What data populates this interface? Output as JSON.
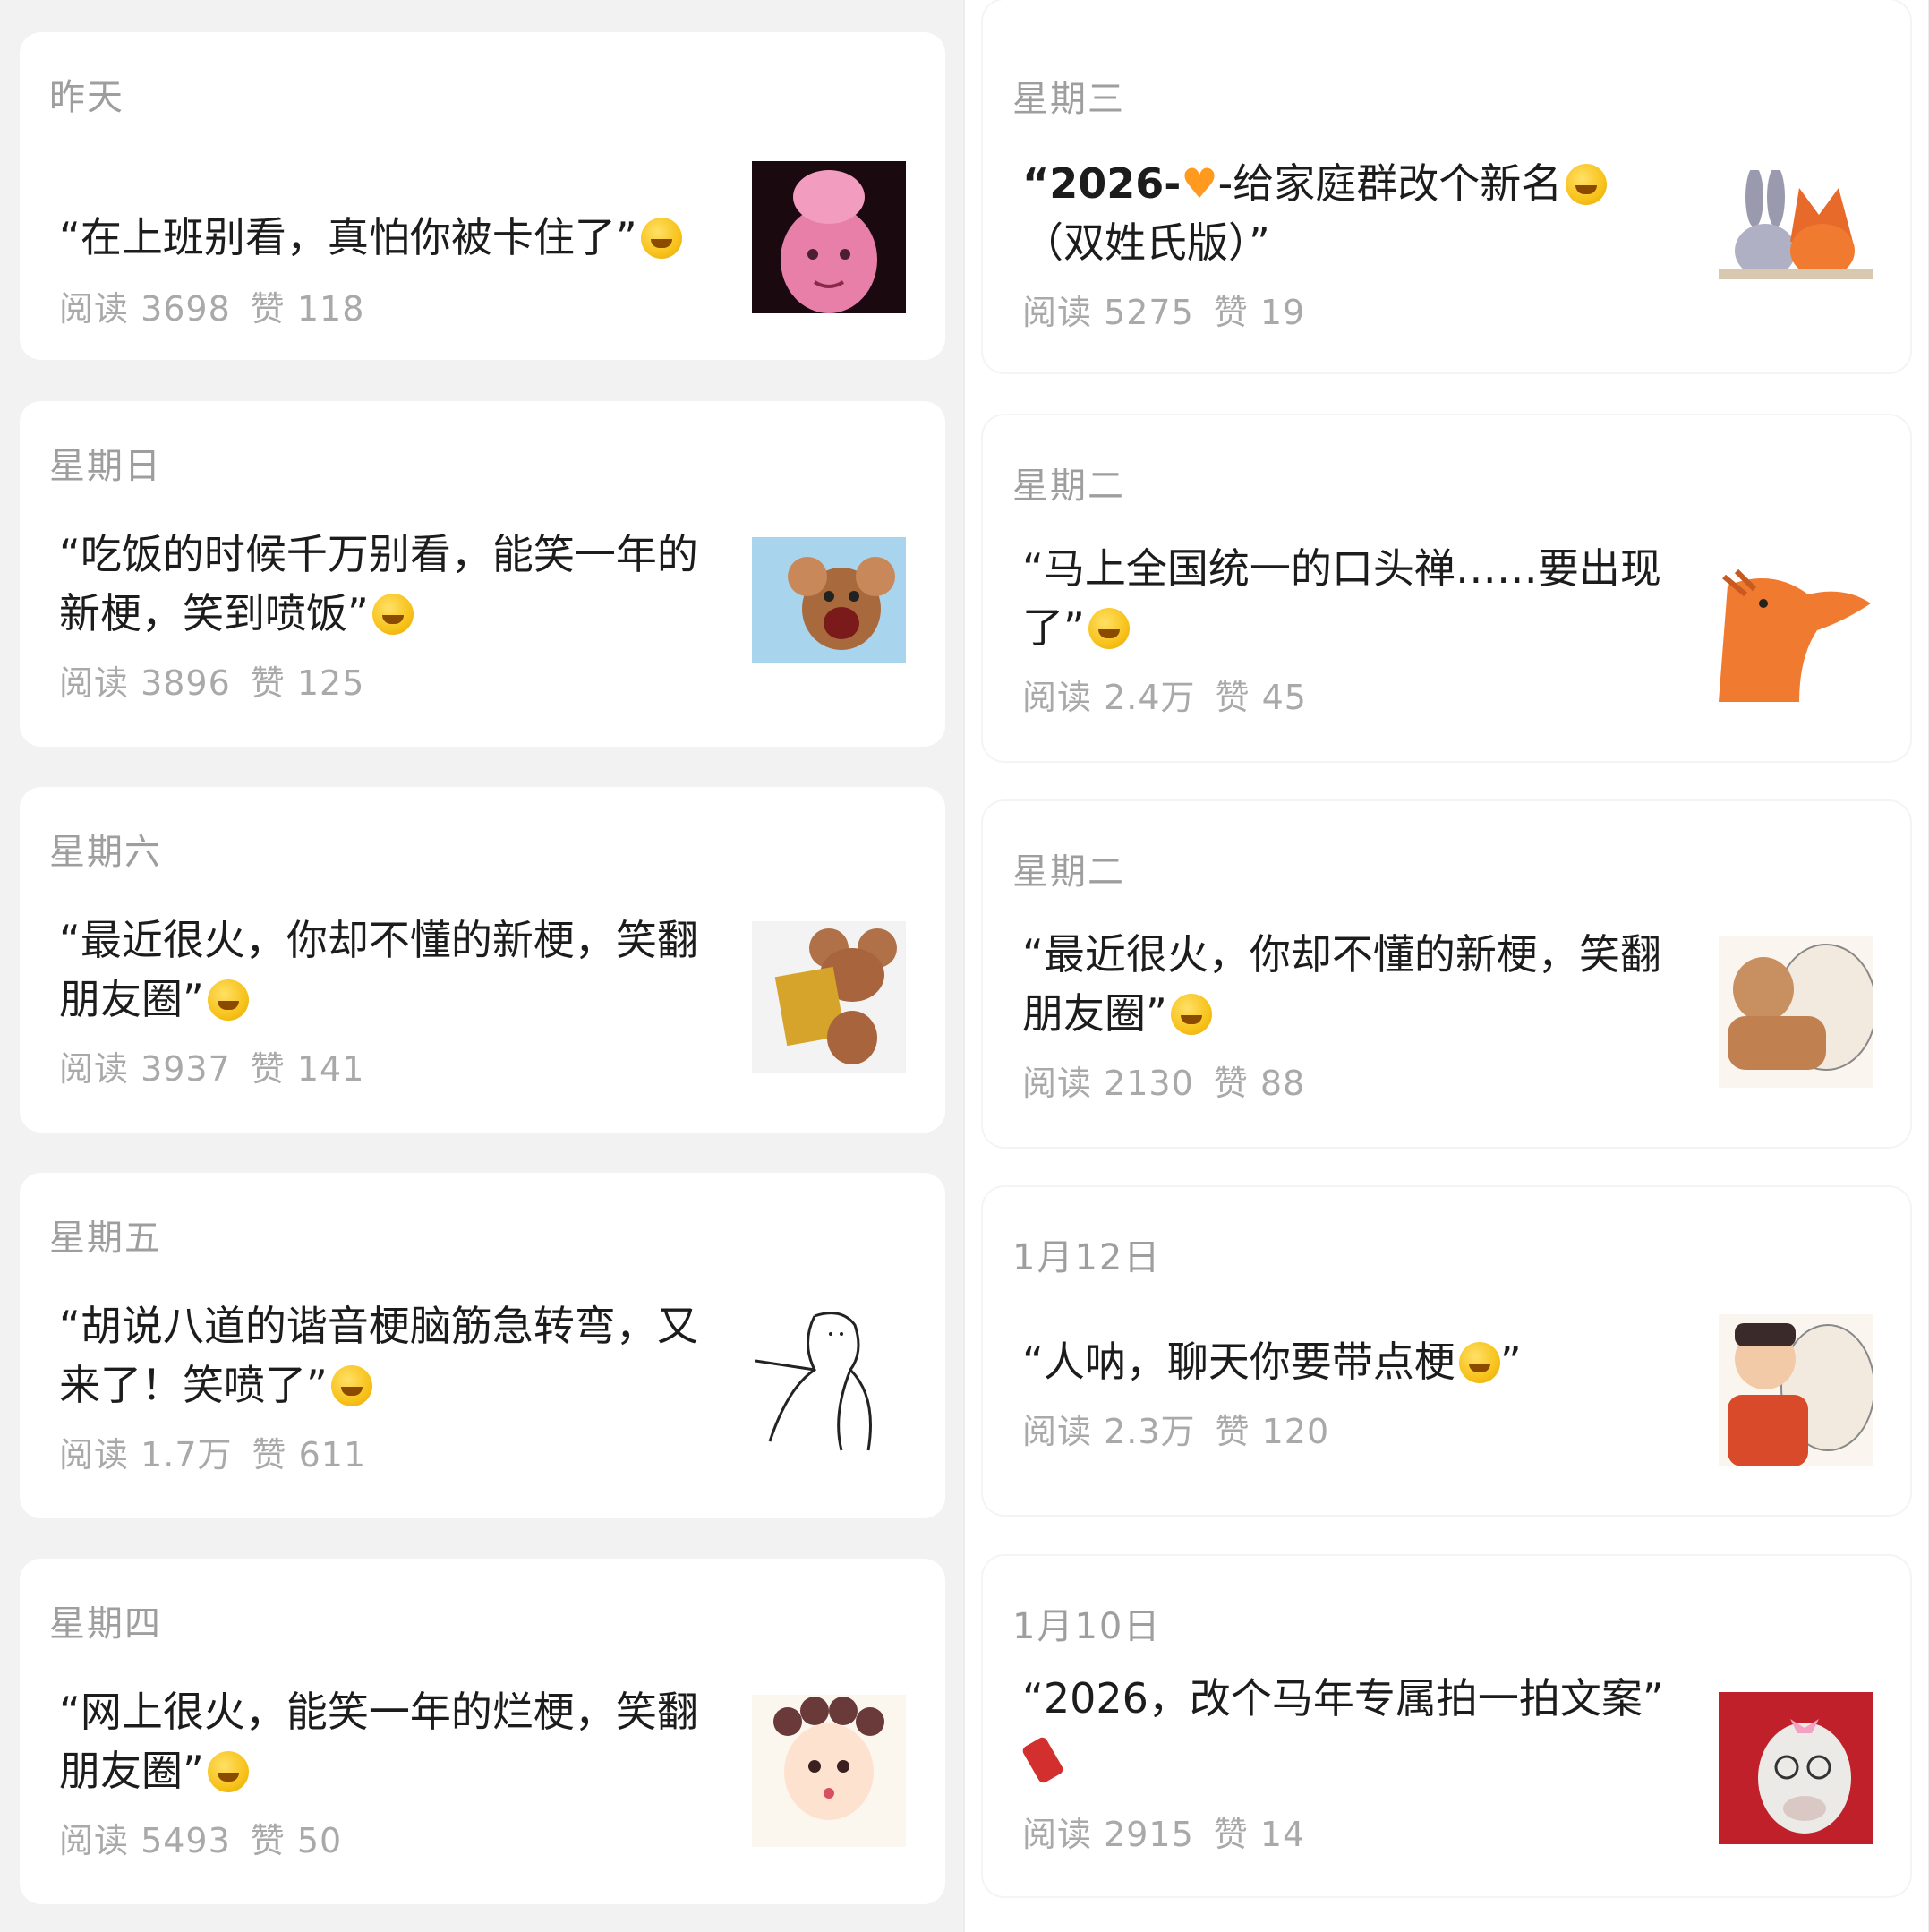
{
  "left": [
    {
      "date": "昨天",
      "title": "“在上班别看，真怕你被卡住了”",
      "meta": {
        "reads": "阅读 3698",
        "likes": "赞 118"
      },
      "emoji": "rolling-on-floor-laughing"
    },
    {
      "date": "星期日",
      "title": "“吃饭的时候千万别看，能笑一年的新梗，笑到喷饭”",
      "meta": {
        "reads": "阅读 3896",
        "likes": "赞 125"
      },
      "emoji": "rolling-on-floor-laughing"
    },
    {
      "date": "星期六",
      "title": "“最近很火，你却不懂的新梗，笑翻朋友圈”",
      "meta": {
        "reads": "阅读 3937",
        "likes": "赞 141"
      },
      "emoji": "rolling-on-floor-laughing"
    },
    {
      "date": "星期五",
      "title": "“胡说八道的谐音梗脑筋急转弯，又来了！笑喷了”",
      "meta": {
        "reads": "阅读 1.7万",
        "likes": "赞 611"
      },
      "emoji": "zany-face"
    },
    {
      "date": "星期四",
      "title": "“网上很火，能笑一年的烂梗，笑翻朋友圈”",
      "meta": {
        "reads": "阅读 5493",
        "likes": "赞 50"
      },
      "emoji": "rolling-on-floor-laughing"
    }
  ],
  "right": [
    {
      "date": "星期三",
      "title_a": "“2026-",
      "title_b": "-给家庭群改个新名",
      "title_c": "（双姓氏版）”",
      "meta": {
        "reads": "阅读 5275",
        "likes": "赞 19"
      },
      "emoji": "zany-face"
    },
    {
      "date": "星期二",
      "title": "“马上全国统一的口头禅……要出现了”",
      "meta": {
        "reads": "阅读 2.4万",
        "likes": "赞 45"
      },
      "emoji": "rolling-on-floor-laughing"
    },
    {
      "date": "星期二",
      "title": "“最近很火，你却不懂的新梗，笑翻朋友圈”",
      "meta": {
        "reads": "阅读 2130",
        "likes": "赞 88"
      },
      "emoji": "rolling-on-floor-laughing"
    },
    {
      "date": "1月12日",
      "title_a": "“人呐，聊天你要带点梗",
      "title_b": "”",
      "meta": {
        "reads": "阅读 2.3万",
        "likes": "赞 120"
      },
      "emoji": "zany-face"
    },
    {
      "date": "1月10日",
      "title": "“2026，改个马年专属拍一拍文案”",
      "meta": {
        "reads": "阅读 2915",
        "likes": "赞 14"
      },
      "emoji": "firecracker"
    }
  ],
  "thumbs": {
    "l0": "pink-monkey-king-thumbnail",
    "l1": "jerry-mouse-laughing-thumbnail",
    "l2": "jerry-mouse-reading-book-thumbnail",
    "l3": "doodle-figure-thumbnail",
    "l4": "girl-hair-rollers-thumbnail",
    "r0": "zootopia-rabbit-fox-thumbnail",
    "r1": "cartoon-horse-thumbnail",
    "r2": "man-hugging-pig-thumbnail",
    "r3": "empress-hugging-pig-thumbnail",
    "r4": "white-horse-pink-bow-thumbnail"
  },
  "colors": {
    "page_bg": "#f2f2f2",
    "card_bg": "#ffffff",
    "date": "#9e9e9e",
    "title": "#1c1c1c",
    "meta": "#a9a9a9"
  }
}
